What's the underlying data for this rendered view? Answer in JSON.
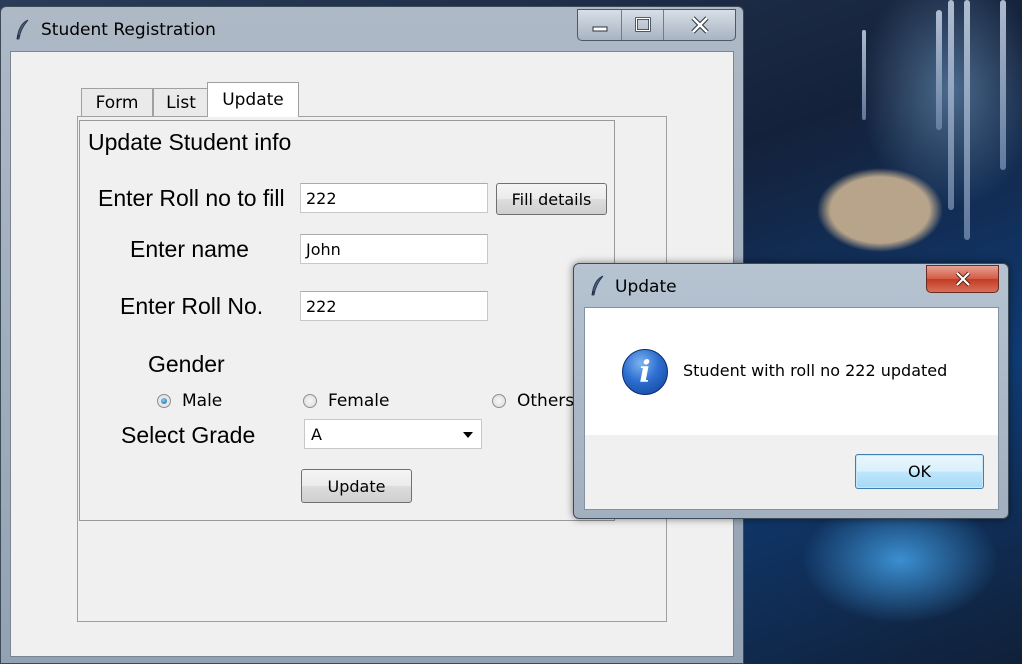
{
  "main_window": {
    "title": "Student Registration",
    "tabs": [
      {
        "label": "Form"
      },
      {
        "label": "List"
      },
      {
        "label": "Update"
      }
    ],
    "section_title": "Update Student info",
    "fill_roll_label": "Enter Roll no to fill",
    "fill_roll_value": "222",
    "fill_button": "Fill details",
    "name_label": "Enter name",
    "name_value": "John",
    "roll_label": "Enter Roll No.",
    "roll_value": "222",
    "gender_label": "Gender",
    "gender_options": [
      "Male",
      "Female",
      "Others"
    ],
    "gender_selected": "Male",
    "grade_label": "Select Grade",
    "grade_value": "A",
    "update_button": "Update"
  },
  "dialog": {
    "title": "Update",
    "message": "Student with roll no 222 updated",
    "ok_button": "OK"
  },
  "colors": {
    "accent": "#3c7fb1",
    "close_red": "#c43b23"
  }
}
